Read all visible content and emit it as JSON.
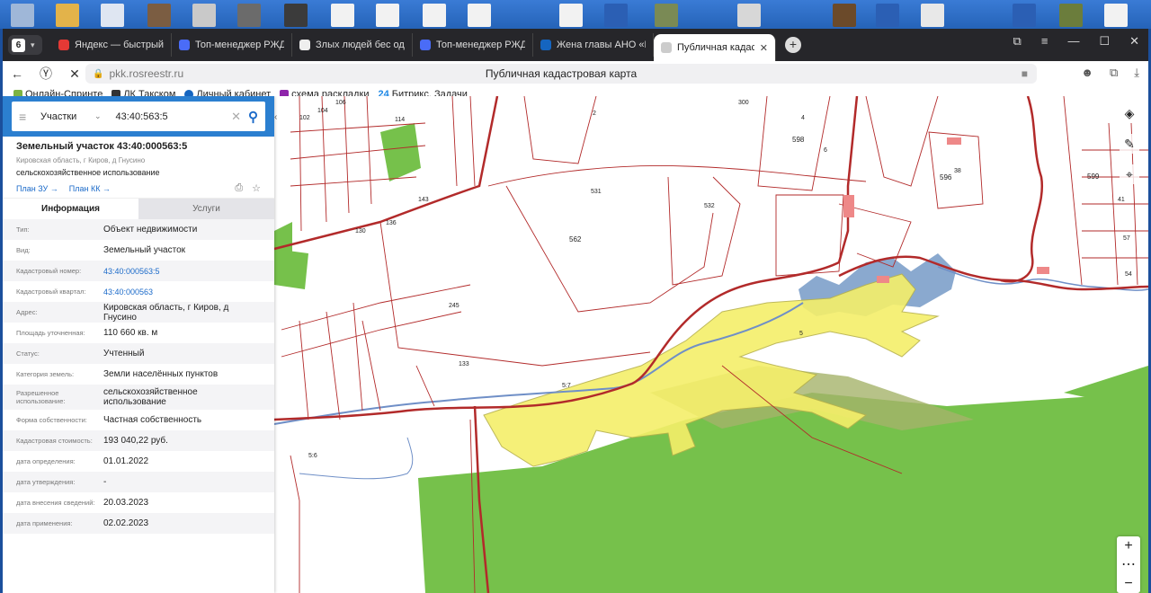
{
  "browser": {
    "tab_count": "6",
    "tabs": [
      {
        "title": "Яндекс — быстрый поиск",
        "color": "#e53935"
      },
      {
        "title": "Топ-менеджер РЖД займ",
        "color": "#4a6cf7"
      },
      {
        "title": "Злых людей бес одевает",
        "color": "#222222"
      },
      {
        "title": "Топ-менеджер РЖД займ",
        "color": "#4a6cf7"
      },
      {
        "title": "Жена главы АНО «Цифр",
        "color": "#1565c0"
      },
      {
        "title": "Публичная кадастрова",
        "color": "#ffffff"
      }
    ],
    "url": "pkk.rosreestr.ru",
    "page_title": "Публичная кадастровая карта",
    "bookmarks": [
      {
        "label": "Онлайн-Спринте",
        "color": "#7cb342"
      },
      {
        "label": "ЛК Такском",
        "color": "#333333"
      },
      {
        "label": "Личный кабинет",
        "color": "#1565c0"
      },
      {
        "label": "схема раскладки",
        "color": "#8e24aa"
      },
      {
        "label": "Битрикс. Задачи",
        "color": "#1e88e5",
        "prefix": "24"
      }
    ]
  },
  "search": {
    "type": "Участки",
    "query": "43:40:563:5"
  },
  "parcel": {
    "title": "Земельный участок 43:40:000563:5",
    "address": "Кировская область, г Киров, д Гнусино",
    "use": "сельскохозяйственное использование",
    "link_plan_zu": "План ЗУ →",
    "link_plan_kk": "План КК →",
    "tab_info": "Информация",
    "tab_services": "Услуги"
  },
  "attributes": [
    {
      "label": "Тип:",
      "value": "Объект недвижимости"
    },
    {
      "label": "Вид:",
      "value": "Земельный участок"
    },
    {
      "label": "Кадастровый номер:",
      "value": "43:40:000563:5",
      "link": true
    },
    {
      "label": "Кадастровый квартал:",
      "value": "43:40:000563",
      "link": true
    },
    {
      "label": "Адрес:",
      "value": "Кировская область, г Киров, д Гнусино"
    },
    {
      "label": "Площадь уточненная:",
      "value": "110 660 кв. м"
    },
    {
      "label": "Статус:",
      "value": "Учтенный"
    },
    {
      "label": "Категория земель:",
      "value": "Земли населённых пунктов"
    },
    {
      "label": "Разрешенное использование:",
      "value": "сельскохозяйственное использование"
    },
    {
      "label": "Форма собственности:",
      "value": "Частная собственность"
    },
    {
      "label": "Кадастровая стоимость:",
      "value": "193 040,22 руб."
    },
    {
      "label": "дата определения:",
      "value": "01.01.2022"
    },
    {
      "label": "дата утверждения:",
      "value": "-"
    },
    {
      "label": "дата внесения сведений:",
      "value": "20.03.2023"
    },
    {
      "label": "дата применения:",
      "value": "02.02.2023"
    }
  ],
  "map_labels": [
    "2",
    "300",
    "4",
    "598",
    "6",
    "596",
    "599",
    "531",
    "562",
    "532",
    "245",
    "133",
    "5",
    "5:7",
    "5:6",
    "38",
    "41",
    "54",
    "57",
    "143",
    "136",
    "130",
    "102",
    "104",
    "106",
    "114"
  ],
  "colors": {
    "accent": "#2b7fd0",
    "parcel_line": "#b22a2a",
    "selected": "#f5ef6a",
    "forest": "#76c14b",
    "water": "#8aa9cf"
  }
}
